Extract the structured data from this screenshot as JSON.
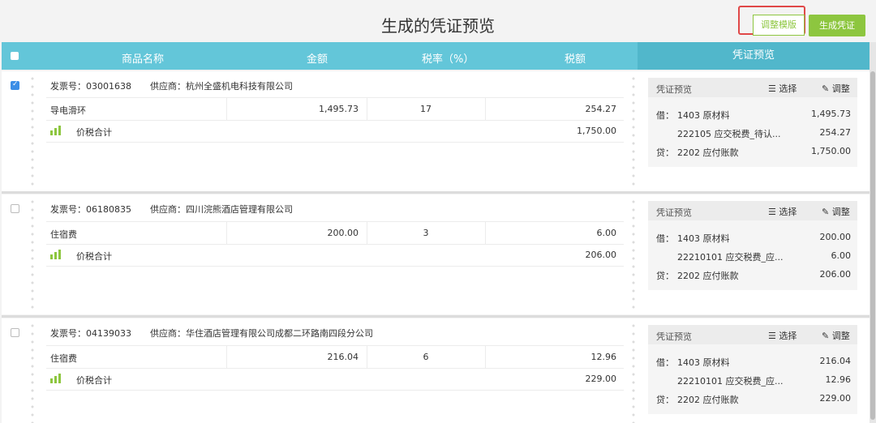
{
  "page": {
    "title": "生成的凭证预览",
    "adjust_template_label": "调整模版",
    "generate_label": "生成凭证"
  },
  "header": {
    "name_col": "商品名称",
    "amount_col": "金额",
    "rate_col": "税率（%）",
    "tax_col": "税额",
    "preview_col": "凭证预览"
  },
  "invoices": [
    {
      "checked": true,
      "invoice_label": "发票号：03001638",
      "supplier_label": "供应商：杭州全盛机电科技有限公司",
      "item": "导电滑环",
      "amount": "1,495.73",
      "rate": "17",
      "tax": "254.27",
      "total_label": "价税合计",
      "total": "1,750.00",
      "preview": {
        "title": "凭证预览",
        "select": "选择",
        "adjust": "调整",
        "debit_label": "借：",
        "credit_label": "贷：",
        "lines": [
          {
            "account": "1403 原材料",
            "amount": "1,495.73"
          },
          {
            "account": "222105 应交税费_待认...",
            "amount": "254.27"
          },
          {
            "account": "2202 应付账款",
            "amount": "1,750.00"
          }
        ]
      }
    },
    {
      "checked": false,
      "invoice_label": "发票号：06180835",
      "supplier_label": "供应商：四川浣熊酒店管理有限公司",
      "item": "住宿费",
      "amount": "200.00",
      "rate": "3",
      "tax": "6.00",
      "total_label": "价税合计",
      "total": "206.00",
      "preview": {
        "title": "凭证预览",
        "select": "选择",
        "adjust": "调整",
        "debit_label": "借：",
        "credit_label": "贷：",
        "lines": [
          {
            "account": "1403 原材料",
            "amount": "200.00"
          },
          {
            "account": "22210101 应交税费_应...",
            "amount": "6.00"
          },
          {
            "account": "2202 应付账款",
            "amount": "206.00"
          }
        ]
      }
    },
    {
      "checked": false,
      "invoice_label": "发票号：04139033",
      "supplier_label": "供应商：华住酒店管理有限公司成都二环路南四段分公司",
      "item": "住宿费",
      "amount": "216.04",
      "rate": "6",
      "tax": "12.96",
      "total_label": "价税合计",
      "total": "229.00",
      "preview": {
        "title": "凭证预览",
        "select": "选择",
        "adjust": "调整",
        "debit_label": "借：",
        "credit_label": "贷：",
        "lines": [
          {
            "account": "1403 原材料",
            "amount": "216.04"
          },
          {
            "account": "22210101 应交税费_应...",
            "amount": "12.96"
          },
          {
            "account": "2202 应付账款",
            "amount": "229.00"
          }
        ]
      }
    }
  ],
  "colors": {
    "header": "#63c6d9",
    "accent": "#8dc63f",
    "highlight": "#e04848"
  }
}
